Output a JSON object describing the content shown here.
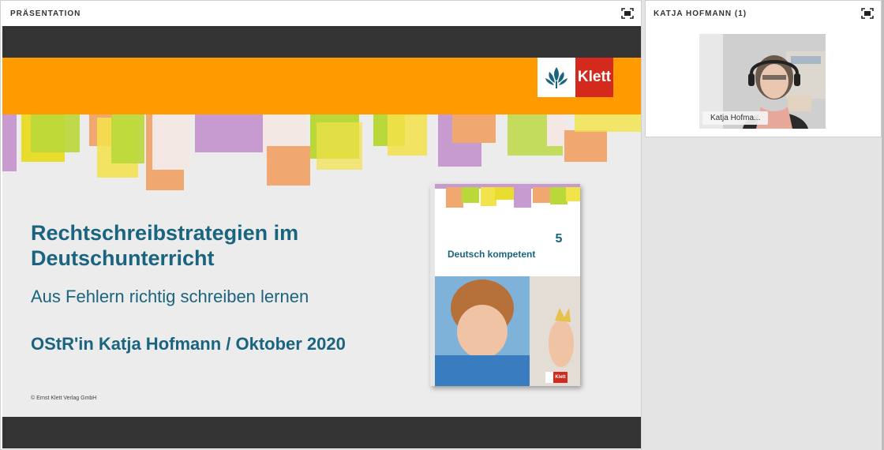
{
  "presentation": {
    "pod_title": "PRÄSENTATION",
    "slide": {
      "title": "Rechtschreibstrategien im Deutschunterricht",
      "subtitle": "Aus Fehlern richtig schreiben lernen",
      "author": "OStR'in Katja Hofmann / Oktober 2020",
      "copyright": "© Ernst Klett Verlag GmbH",
      "logo_text": "Klett",
      "book": {
        "number": "5",
        "title": "Deutsch kompetent",
        "logo_text": "Klett"
      }
    }
  },
  "video": {
    "pod_title": "KATJA HOFMANN (1)",
    "participant_label": "Katja Hofma..."
  },
  "colors": {
    "accent_orange": "#ff9a00",
    "title_blue": "#1a6480",
    "klett_red": "#d42a1e"
  },
  "icons": {
    "maximize": "maximize-icon"
  }
}
